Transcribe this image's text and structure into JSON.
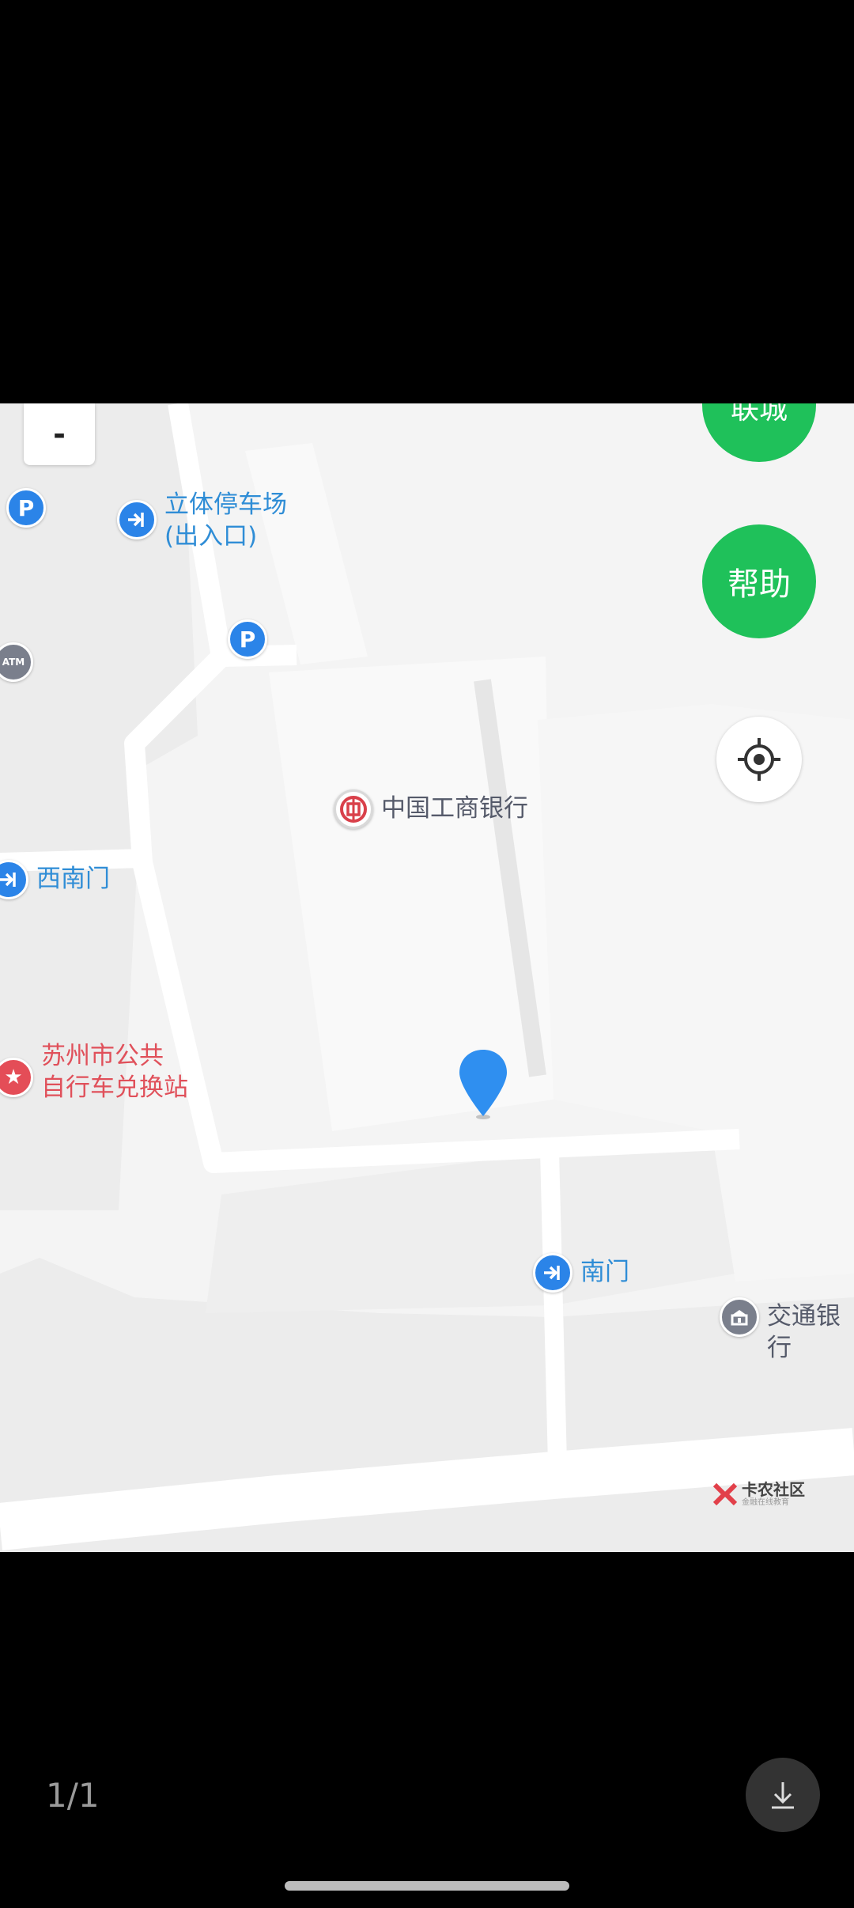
{
  "map": {
    "zoom_out_label": "-",
    "top_button_label": "联城",
    "help_button_label": "帮助",
    "locate_icon": "crosshair-icon",
    "pois": {
      "parking_garage": "立体停车场\n(出入口)",
      "icbc": "中国工商银行",
      "west_south_gate": "西南门",
      "bike_station": "苏州市公共\n自行车兑换站",
      "south_gate": "南门",
      "bocom": "交通银行"
    },
    "icon_text": {
      "parking": "P",
      "atm": "ATM"
    },
    "watermark": {
      "title": "卡农社区",
      "subtitle": "金融在线教育"
    },
    "colors": {
      "accent_green": "#1fc15a",
      "poi_blue": "#2b84e8",
      "poi_red": "#e44d57",
      "poi_gray": "#7a7f8c"
    }
  },
  "viewer": {
    "page_counter": "1/1",
    "download_icon": "download-icon"
  }
}
